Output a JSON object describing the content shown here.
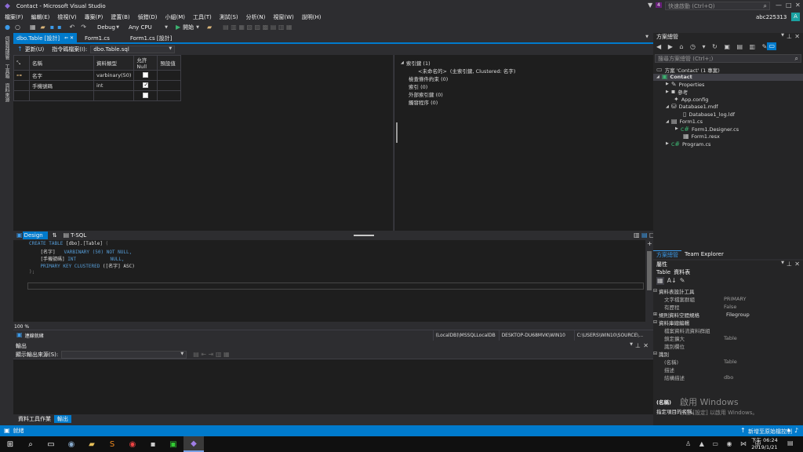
{
  "window": {
    "title": "Contact - Microsoft Visual Studio",
    "quick_launch": "快速啟動 (Ctrl+Q)",
    "user": "abc225313",
    "avatar_letter": "A",
    "notif_count": "4"
  },
  "menu": [
    "檔案(F)",
    "編輯(E)",
    "檢視(V)",
    "專案(P)",
    "建置(B)",
    "偵錯(D)",
    "小組(M)",
    "工具(T)",
    "測試(S)",
    "分析(N)",
    "視窗(W)",
    "說明(H)"
  ],
  "toolbar": {
    "config": "Debug",
    "platform": "Any CPU",
    "start": "開始"
  },
  "left_strip": [
    "伺服器總管",
    "工具箱",
    "資料來源"
  ],
  "tabs": [
    {
      "label": "dbo.Table [設計]",
      "active": true,
      "pin": "⇐ ✕"
    },
    {
      "label": "Form1.cs"
    },
    {
      "label": "Form1.cs [設計]"
    }
  ],
  "designer": {
    "update": "更新(U)",
    "script_label": "指令碼檔案(I):",
    "script_file": "dbo.Table.sql"
  },
  "grid": {
    "headers": [
      "名稱",
      "資料類型",
      "允許 Null",
      "預設值"
    ],
    "rows": [
      {
        "name": "名字",
        "type": "varbinary(50)",
        "nullable": false,
        "default": "",
        "key": true
      },
      {
        "name": "手機號碼",
        "type": "int",
        "nullable": true,
        "default": ""
      },
      {
        "name": "",
        "type": "",
        "nullable": false,
        "default": ""
      }
    ]
  },
  "keys": {
    "index_keys": "索引鍵 (1)",
    "pk_name": "<未命名的>",
    "pk_detail": "(主索引鍵, Clustered: 名字)",
    "check": "檢查條件約束 (0)",
    "index": "索引 (0)",
    "fk": "外部索引鍵 (0)",
    "trigger": "觸發程序 (0)"
  },
  "split": {
    "design": "Design",
    "tsql": "T-SQL",
    "swap": "⇅"
  },
  "sql": {
    "l1_kw": "CREATE TABLE",
    "l1_rest": " [dbo].[Table]",
    "l1_paren": " (",
    "l2_name": "    [名字]",
    "l2_type": "   VARBINARY (50) NOT NULL,",
    "l3_name": "    [手機號碼]",
    "l3_type": " INT            NULL,",
    "l4_kw": "    PRIMARY KEY CLUSTERED",
    "l4_rest": " ([名字] ASC)",
    "l5": ");"
  },
  "status_inner": {
    "zoom": "100 %",
    "connection": "連線就緒",
    "server": "(LocalDB)\\MSSQLLocalDB",
    "machine": "DESKTOP-DU68MVK\\WIN10",
    "path": "C:\\USERS\\WIN10\\SOURCE\\..."
  },
  "output": {
    "title": "輸出",
    "source_label": "顯示輸出來源(S):"
  },
  "bottom_tabs": [
    "資料工具作業",
    "輸出"
  ],
  "solution": {
    "title": "方案總管",
    "search": "搜尋方案總管 (Ctrl+;)",
    "items": [
      {
        "label": "方案 'Contact' (1 專案)",
        "indent": 0
      },
      {
        "label": "Contact",
        "indent": 1,
        "bold": true
      },
      {
        "label": "Properties",
        "indent": 2
      },
      {
        "label": "參考",
        "indent": 2
      },
      {
        "label": "App.config",
        "indent": 2
      },
      {
        "label": "Database1.mdf",
        "indent": 2
      },
      {
        "label": "Database1_log.ldf",
        "indent": 3
      },
      {
        "label": "Form1.cs",
        "indent": 2
      },
      {
        "label": "Form1.Designer.cs",
        "indent": 3
      },
      {
        "label": "Form1.resx",
        "indent": 3
      },
      {
        "label": "Program.cs",
        "indent": 2
      }
    ],
    "tabs": [
      "方案總管",
      "Team Explorer"
    ]
  },
  "props": {
    "title": "屬性",
    "object": "Table",
    "object_type": "資料表",
    "groups": [
      {
        "name": "資料表設計工具",
        "rows": [
          [
            "文字檔案群組",
            "PRIMARY"
          ],
          [
            "有歷程",
            "False"
          ]
        ]
      },
      {
        "name": "規則資料空間規格",
        "rows": [],
        "value": "Filegroup",
        "collapsed": true
      },
      {
        "name": "資料庫總編輯",
        "rows": [
          [
            "檔案資料流資料群組",
            ""
          ],
          [
            "鎖定擴大",
            "Table"
          ],
          [
            "識別欄位",
            ""
          ]
        ]
      },
      {
        "name": "識別",
        "rows": [
          [
            "(名稱)",
            "Table"
          ],
          [
            "描述",
            ""
          ],
          [
            "結構描述",
            "dbo"
          ]
        ]
      }
    ],
    "desc_title": "(名稱)",
    "desc_text": "指定項目的名稱。",
    "windows_watermark": "啟用 Windows",
    "windows_watermark2": "移至 [設定] 以啟用 Windows。"
  },
  "statusbar": {
    "text": "就緒",
    "right": "新增至原始檔控制"
  },
  "taskbar": {
    "time": "下午 06:24",
    "date": "2019/1/21"
  }
}
